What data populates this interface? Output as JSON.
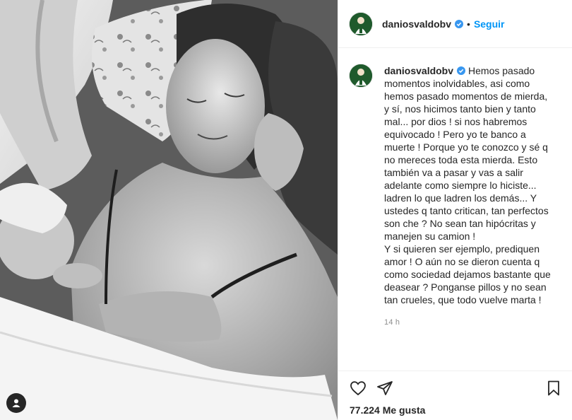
{
  "post": {
    "username": "daniosvaldobv",
    "follow_label": "Seguir",
    "separator": "•",
    "caption": "Hemos pasado momentos inolvidables, asi como hemos pasado momentos de mierda, y sí, nos hicimos tanto bien y tanto mal... por dios ! si nos habremos equivocado ! Pero yo te banco a muerte ! Porque yo te conozco y sé q no mereces toda esta mierda. Esto también va a pasar y vas a salir adelante como siempre lo hiciste... ladren lo que ladren los demás... Y ustedes q tanto critican, tan perfectos son che ? No sean tan hipócritas y manejen su camion !\nY si quieren ser ejemplo, prediquen amor ! O aún no se dieron cuenta q como sociedad dejamos bastante que deasear ? Ponganse pillos y no sean tan crueles, que todo vuelve marta !",
    "time_ago": "14 h",
    "likes_text": "77.224 Me gusta"
  },
  "colors": {
    "accent": "#0095f6",
    "verified": "#3897f0",
    "text": "#262626",
    "muted": "#8e8e8e",
    "border": "#efefef"
  },
  "icons": {
    "like": "heart-icon",
    "share": "paper-plane-icon",
    "save": "bookmark-icon",
    "tags": "user-tag-icon",
    "verified": "verified-badge-icon"
  }
}
